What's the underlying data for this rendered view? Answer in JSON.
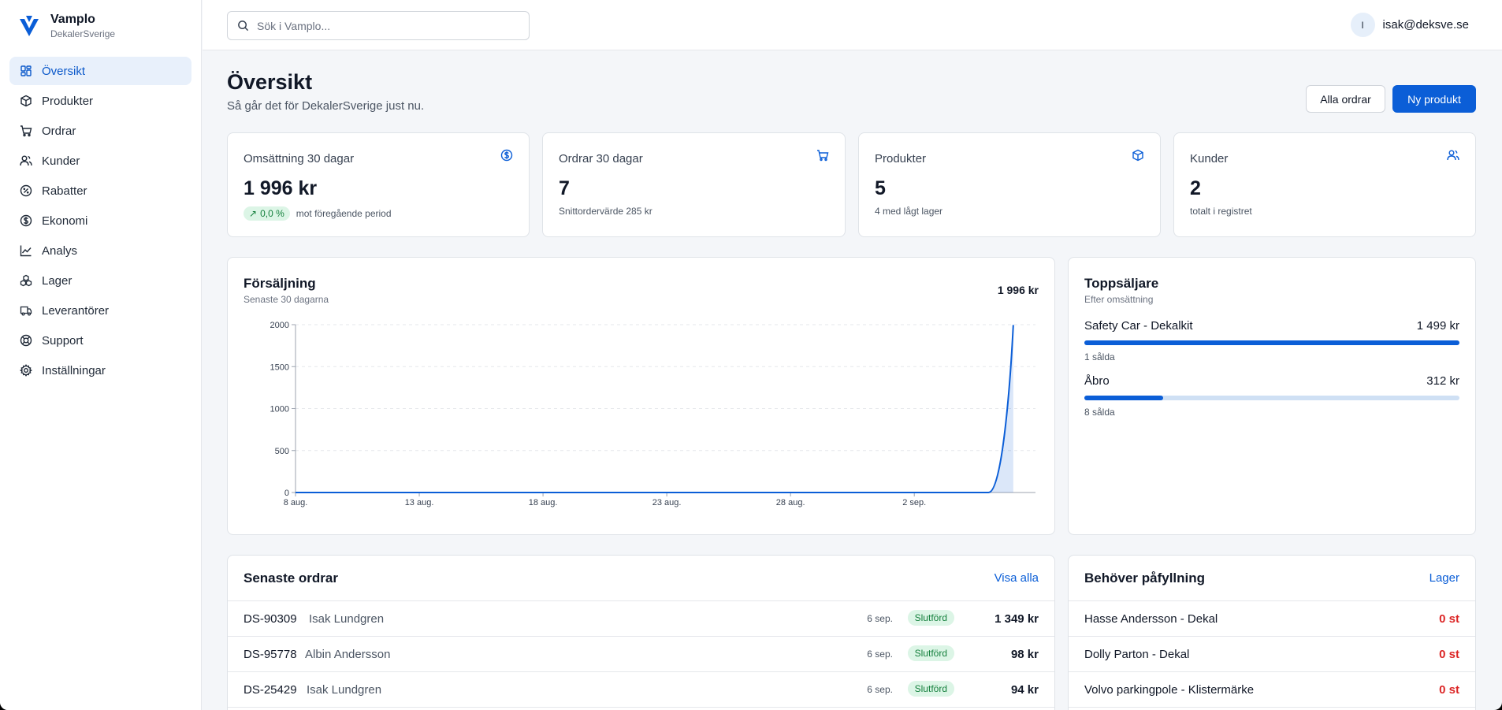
{
  "brand": {
    "name": "Vamplo",
    "org": "DekalerSverige"
  },
  "sidebar": {
    "items": [
      {
        "label": "Översikt",
        "icon": "dashboard-icon",
        "active": true
      },
      {
        "label": "Produkter",
        "icon": "package-icon"
      },
      {
        "label": "Ordrar",
        "icon": "cart-icon"
      },
      {
        "label": "Kunder",
        "icon": "users-icon"
      },
      {
        "label": "Rabatter",
        "icon": "percent-icon"
      },
      {
        "label": "Ekonomi",
        "icon": "dollar-icon"
      },
      {
        "label": "Analys",
        "icon": "line-chart-icon"
      },
      {
        "label": "Lager",
        "icon": "boxes-icon"
      },
      {
        "label": "Leverantörer",
        "icon": "truck-icon"
      },
      {
        "label": "Support",
        "icon": "lifebuoy-icon"
      },
      {
        "label": "Inställningar",
        "icon": "gear-icon"
      }
    ]
  },
  "search": {
    "placeholder": "Sök i Vamplo...",
    "value": ""
  },
  "user": {
    "initial": "I",
    "email": "isak@deksve.se"
  },
  "page": {
    "title": "Översikt",
    "subtitle": "Så går det för DekalerSverige just nu.",
    "btn_orders": "Alla ordrar",
    "btn_new": "Ny produkt"
  },
  "stats": [
    {
      "label": "Omsättning 30 dagar",
      "value": "1 996 kr",
      "badge": "0,0 %",
      "note": "mot föregående period",
      "icon": "dollar-icon"
    },
    {
      "label": "Ordrar 30 dagar",
      "value": "7",
      "note": "Snittordervärde 285 kr",
      "icon": "cart-icon"
    },
    {
      "label": "Produkter",
      "value": "5",
      "note": "4 med lågt lager",
      "icon": "package-icon"
    },
    {
      "label": "Kunder",
      "value": "2",
      "note": "totalt i registret",
      "icon": "users-icon"
    }
  ],
  "sales": {
    "title": "Försäljning",
    "subtitle": "Senaste 30 dagarna",
    "total": "1 996 kr"
  },
  "chart_data": {
    "type": "area",
    "title": "Försäljning",
    "xlabel": "",
    "ylabel": "",
    "ylim": [
      0,
      2000
    ],
    "yticks": [
      0,
      500,
      1000,
      1500,
      2000
    ],
    "xticks": [
      "8 aug.",
      "13 aug.",
      "18 aug.",
      "23 aug.",
      "28 aug.",
      "2 sep."
    ],
    "x": [
      "8 aug.",
      "9 aug.",
      "10 aug.",
      "11 aug.",
      "12 aug.",
      "13 aug.",
      "14 aug.",
      "15 aug.",
      "16 aug.",
      "17 aug.",
      "18 aug.",
      "19 aug.",
      "20 aug.",
      "21 aug.",
      "22 aug.",
      "23 aug.",
      "24 aug.",
      "25 aug.",
      "26 aug.",
      "27 aug.",
      "28 aug.",
      "29 aug.",
      "30 aug.",
      "31 aug.",
      "1 sep.",
      "2 sep.",
      "3 sep.",
      "4 sep.",
      "5 sep.",
      "6 sep."
    ],
    "values": [
      0,
      0,
      0,
      0,
      0,
      0,
      0,
      0,
      0,
      0,
      0,
      0,
      0,
      0,
      0,
      0,
      0,
      0,
      0,
      0,
      0,
      0,
      0,
      0,
      0,
      0,
      0,
      0,
      0,
      1996
    ],
    "color": "#0b5ed7",
    "grid": true
  },
  "topsellers": {
    "title": "Toppsäljare",
    "subtitle": "Efter omsättning",
    "items": [
      {
        "name": "Safety Car - Dekalkit",
        "amount": "1 499 kr",
        "sold": "1 sålda",
        "share": 1.0
      },
      {
        "name": "Åbro",
        "amount": "312 kr",
        "sold": "8 sålda",
        "share": 0.21
      }
    ]
  },
  "orders": {
    "title": "Senaste ordrar",
    "link": "Visa alla",
    "rows": [
      {
        "id": "DS-90309",
        "customer": "Isak Lundgren",
        "date": "6 sep.",
        "status": "Slutförd",
        "amount": "1 349 kr"
      },
      {
        "id": "DS-95778",
        "customer": "Albin Andersson",
        "date": "6 sep.",
        "status": "Slutförd",
        "amount": "98 kr"
      },
      {
        "id": "DS-25429",
        "customer": "Isak Lundgren",
        "date": "6 sep.",
        "status": "Slutförd",
        "amount": "94 kr"
      }
    ]
  },
  "restock": {
    "title": "Behöver påfyllning",
    "link": "Lager",
    "rows": [
      {
        "name": "Hasse Andersson - Dekal",
        "qty": "0 st"
      },
      {
        "name": "Dolly Parton - Dekal",
        "qty": "0 st"
      },
      {
        "name": "Volvo parkingpole - Klistermärke",
        "qty": "0 st"
      }
    ]
  }
}
